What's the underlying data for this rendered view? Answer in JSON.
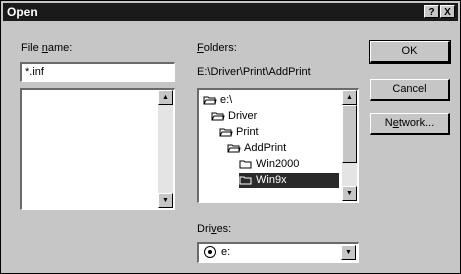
{
  "window": {
    "title": "Open",
    "help_glyph": "?",
    "close_glyph": "X"
  },
  "file_name": {
    "label_pre": "File ",
    "label_u": "n",
    "label_post": "ame:",
    "value": "*.inf"
  },
  "folders": {
    "label_u": "F",
    "label_post": "olders:",
    "current_path": "E:\\Driver\\Print\\AddPrint",
    "tree": [
      {
        "label": "e:\\",
        "icon": "drive-folder-open-icon"
      },
      {
        "label": "Driver",
        "icon": "folder-open-icon"
      },
      {
        "label": "Print",
        "icon": "folder-open-icon"
      },
      {
        "label": "AddPrint",
        "icon": "folder-open-icon"
      },
      {
        "label": "Win2000",
        "icon": "folder-closed-icon"
      },
      {
        "label": "Win9x",
        "icon": "folder-closed-icon",
        "selected": true
      }
    ]
  },
  "drives": {
    "label_pre": "Dri",
    "label_u": "v",
    "label_post": "es:",
    "value": "e:"
  },
  "buttons": {
    "ok": "OK",
    "cancel": "Cancel",
    "network_pre": "N",
    "network_u": "e",
    "network_post": "twork..."
  }
}
